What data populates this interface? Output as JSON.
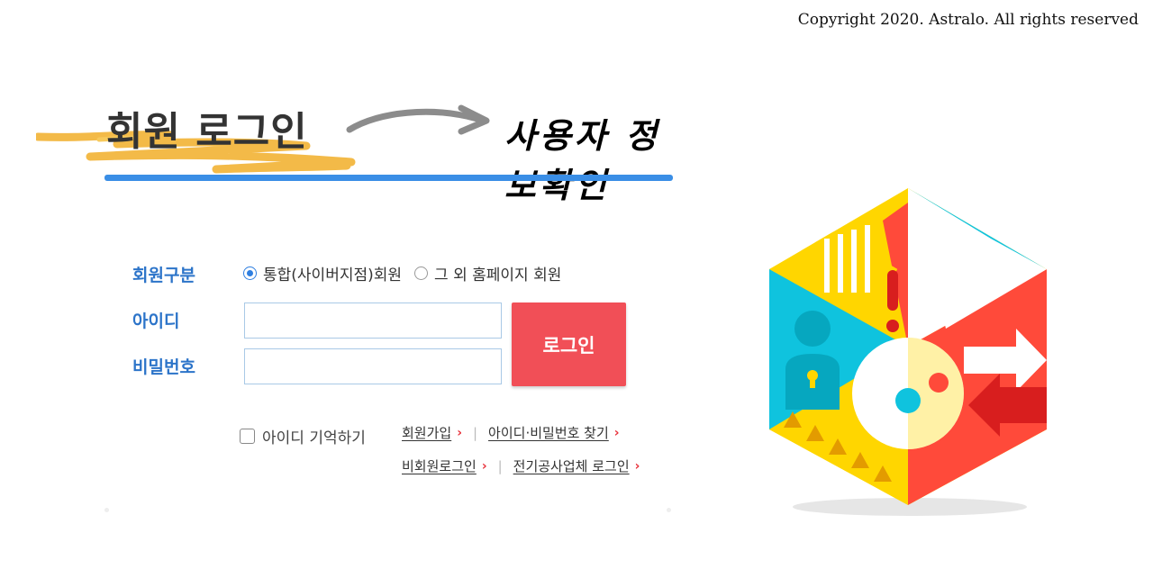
{
  "copyright": "Copyright 2020. Astralo. All rights reserved",
  "header": {
    "title": "회원 로그인",
    "subtitle": "사용자 정보확인"
  },
  "form": {
    "member_type_label": "회원구분",
    "member_type_options": [
      "통합(사이버지점)회원",
      "그 외 홈페이지 회원"
    ],
    "member_type_selected": "통합(사이버지점)회원",
    "id_label": "아이디",
    "id_value": "",
    "password_label": "비밀번호",
    "password_value": "",
    "login_button": "로그인",
    "remember_id": "아이디 기억하기",
    "remember_checked": false
  },
  "links": {
    "signup": "회원가입",
    "find_id_pw": "아이디·비밀번호 찾기",
    "guest_login": "비회원로그인",
    "contractor_login": "전기공사업체 로그인"
  },
  "colors": {
    "accent_blue": "#2c74c9",
    "login_red": "#f14f57",
    "underline_blue": "#3a8ee6"
  }
}
